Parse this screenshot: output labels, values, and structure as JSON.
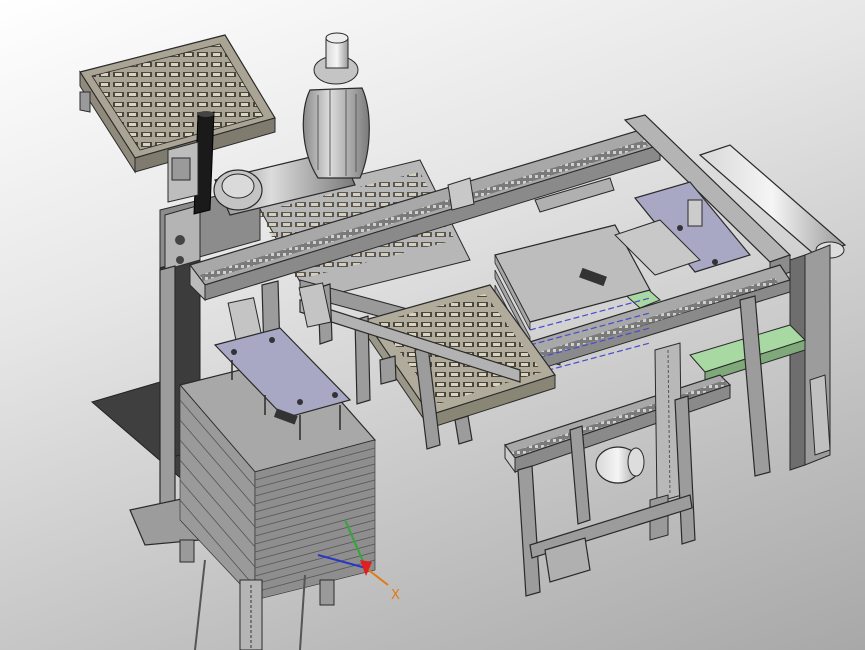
{
  "viewport": {
    "background_top": "#ffffff",
    "background_bottom": "#a8a8a8"
  },
  "triad": {
    "x_label": "X",
    "x_color": "#e07a12",
    "y_color": "#35a535",
    "z_color": "#2a36c8",
    "origin_color": "#e02020"
  },
  "colors": {
    "frame": "#9c9c9c",
    "frame_light": "#c8c8c8",
    "frame_dark": "#6e6e6e",
    "outline": "#2a2a2a",
    "plate": "#a8a8c4",
    "tray": "#b0ab9a",
    "belt": "#a9d9a3",
    "panel_dark": "#3a3a3a"
  }
}
